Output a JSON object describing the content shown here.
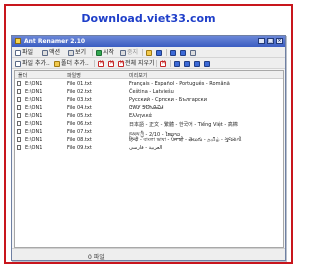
{
  "banner": {
    "title": "Download.viet33.com"
  },
  "window": {
    "title": "Ant Renamer 2.10"
  },
  "toolbar1": [
    {
      "label": "파일",
      "icon": "doc"
    },
    {
      "label": "액션",
      "icon": "gear"
    },
    {
      "label": "보기",
      "icon": "list"
    },
    {
      "label": "시작",
      "icon": "play"
    },
    {
      "label": "중지",
      "icon": "stop"
    }
  ],
  "toolbar2": [
    {
      "label": "파일 추가..",
      "icon": "add-file"
    },
    {
      "label": "폴더 추가..",
      "icon": "add-folder"
    },
    {
      "label": "전체 지우기",
      "icon": "clear"
    }
  ],
  "columns": {
    "folder": "폴더",
    "filename": "파일명",
    "preview": "미리보기"
  },
  "rows": [
    {
      "folder": "E:\\ON1",
      "filename": "File 01.txt",
      "preview": "Français - Español - Português - Română"
    },
    {
      "folder": "E:\\ON1",
      "filename": "File 02.txt",
      "preview": "Čeština - Latviešu"
    },
    {
      "folder": "E:\\ON1",
      "filename": "File 03.txt",
      "preview": "Русский - Српски - Български"
    },
    {
      "folder": "E:\\ON1",
      "filename": "File 04.txt",
      "preview": "ᏣᎳᎩ ᎦᏬᏂᎯᏍᏗ"
    },
    {
      "folder": "E:\\ON1",
      "filename": "File 05.txt",
      "preview": "Ελληνικά"
    },
    {
      "folder": "E:\\ON1",
      "filename": "File 06.txt",
      "preview": "日本語 - 正文 - 繁體 - 한국어 - Tiếng Việt - 高棉"
    },
    {
      "folder": "E:\\ON1",
      "filename": "File 07.txt",
      "preview": "ཁམས་ཀྱི - 2/10 - ໄທລາວ"
    },
    {
      "folder": "E:\\ON1",
      "filename": "File 08.txt",
      "preview": "हिन्दी - বাংলা ভাষা - ਪੰਜਾਬੀ - తెలుగు - தமிழ் - ગુજરાતી"
    },
    {
      "folder": "E:\\ON1",
      "filename": "File 09.txt",
      "preview": "العربية - فارسی"
    }
  ],
  "status": {
    "text": "0 파일"
  }
}
